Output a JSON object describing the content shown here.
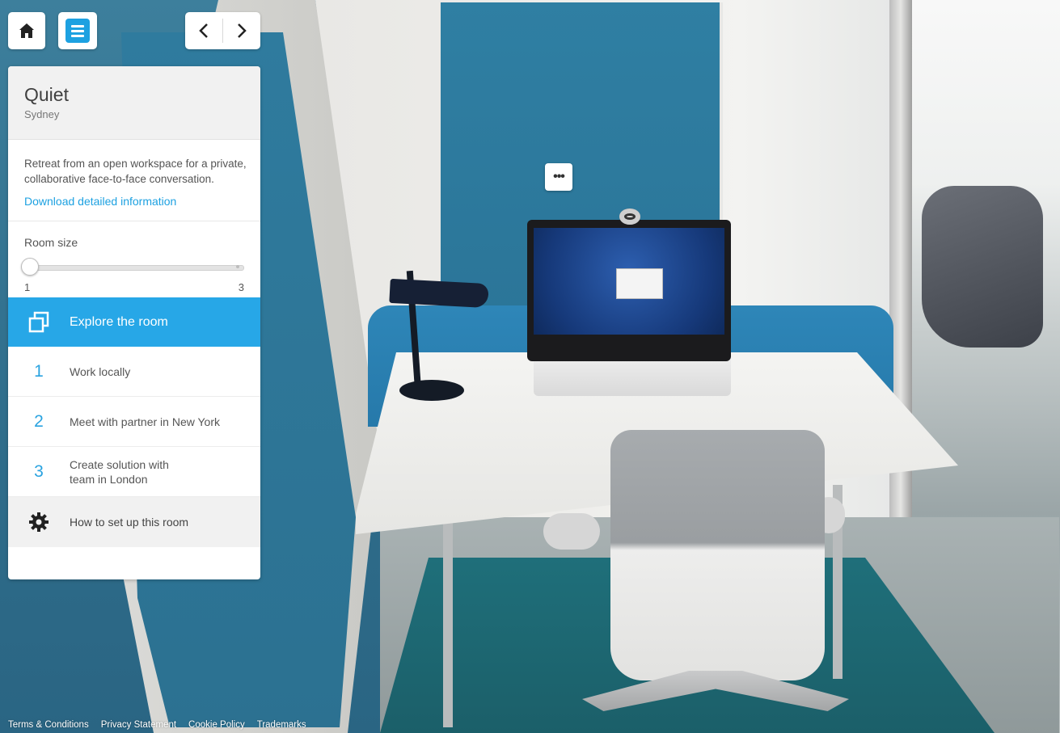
{
  "room": {
    "name": "Quiet",
    "city": "Sydney",
    "description": "Retreat from an open workspace for a private, collaborative face-to-face conversation.",
    "download_label": "Download detailed information"
  },
  "room_size": {
    "label": "Room size",
    "min": "1",
    "max": "3",
    "value": 1
  },
  "explore_label": "Explore the room",
  "steps": [
    {
      "num": "1",
      "label": "Work locally"
    },
    {
      "num": "2",
      "label": "Meet with partner in New York"
    },
    {
      "num": "3",
      "label": "Create solution with team in London"
    }
  ],
  "setup_label": "How to set up this room",
  "hotspot_label": "•••",
  "footer_links": [
    "Terms & Conditions",
    "Privacy Statement",
    "Cookie Policy",
    "Trademarks"
  ],
  "icons": {
    "home": "home-icon",
    "menu": "menu-icon",
    "prev": "chevron-left-icon",
    "next": "chevron-right-icon",
    "explore": "copy-squares-icon",
    "setup": "gear-icon"
  },
  "colors": {
    "accent": "#27a7e7",
    "step_number": "#2aa3e0"
  }
}
